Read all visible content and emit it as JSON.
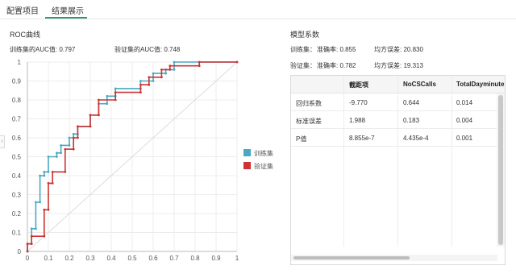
{
  "tabs": [
    {
      "label": "配置项目",
      "active": false
    },
    {
      "label": "结果展示",
      "active": true
    }
  ],
  "roc": {
    "title": "ROC曲线",
    "train_auc_label": "训练集的AUC值: 0.797",
    "valid_auc_label": "验证集的AUC值: 0.748",
    "legend": [
      {
        "name": "训练集",
        "color": "#4aa9c0"
      },
      {
        "name": "验证集",
        "color": "#cc3333"
      }
    ]
  },
  "chart_data": {
    "type": "line",
    "title": "",
    "xlabel": "",
    "ylabel": "",
    "xlim": [
      0,
      1
    ],
    "ylim": [
      0,
      1
    ],
    "xticks": [
      "0",
      "0.1",
      "0.2",
      "0.3",
      "0.4",
      "0.5",
      "0.6",
      "0.7",
      "0.8",
      "0.9",
      "1"
    ],
    "yticks": [
      "0",
      "0.1",
      "0.2",
      "0.3",
      "0.4",
      "0.5",
      "0.6",
      "0.7",
      "0.8",
      "0.9",
      "1"
    ],
    "grid": true,
    "legend_position": "right",
    "diagonal": true,
    "series": [
      {
        "name": "训练集",
        "color": "#4aa9c0",
        "x": [
          0,
          0,
          0.02,
          0.02,
          0.04,
          0.04,
          0.06,
          0.06,
          0.08,
          0.08,
          0.1,
          0.1,
          0.14,
          0.14,
          0.16,
          0.16,
          0.2,
          0.2,
          0.22,
          0.22,
          0.24,
          0.24,
          0.3,
          0.3,
          0.34,
          0.34,
          0.38,
          0.38,
          0.42,
          0.42,
          0.54,
          0.54,
          0.6,
          0.6,
          0.66,
          0.66,
          0.7,
          0.7,
          1.0
        ],
        "y": [
          0,
          0.04,
          0.04,
          0.12,
          0.12,
          0.26,
          0.26,
          0.4,
          0.4,
          0.42,
          0.42,
          0.5,
          0.5,
          0.52,
          0.52,
          0.56,
          0.56,
          0.6,
          0.6,
          0.62,
          0.62,
          0.66,
          0.66,
          0.72,
          0.72,
          0.78,
          0.78,
          0.82,
          0.82,
          0.86,
          0.86,
          0.9,
          0.9,
          0.94,
          0.94,
          0.96,
          0.96,
          1.0,
          1.0
        ]
      },
      {
        "name": "验证集",
        "color": "#cc3333",
        "x": [
          0,
          0,
          0.02,
          0.02,
          0.08,
          0.08,
          0.1,
          0.1,
          0.12,
          0.12,
          0.18,
          0.18,
          0.22,
          0.22,
          0.24,
          0.24,
          0.3,
          0.3,
          0.34,
          0.34,
          0.42,
          0.42,
          0.54,
          0.54,
          0.58,
          0.58,
          0.64,
          0.64,
          0.68,
          0.68,
          0.82,
          0.82,
          1.0
        ],
        "y": [
          0,
          0.04,
          0.04,
          0.08,
          0.08,
          0.22,
          0.22,
          0.36,
          0.36,
          0.42,
          0.42,
          0.54,
          0.54,
          0.6,
          0.6,
          0.66,
          0.66,
          0.72,
          0.72,
          0.8,
          0.8,
          0.84,
          0.84,
          0.88,
          0.88,
          0.92,
          0.92,
          0.96,
          0.96,
          0.98,
          0.98,
          1.0,
          1.0
        ]
      }
    ]
  },
  "model": {
    "title": "模型系数",
    "train_stats": {
      "label": "训练集：",
      "acc_label": "准确率: 0.855",
      "mse_label": "均方误差: 20.830"
    },
    "valid_stats": {
      "label": "验证集：",
      "acc_label": "准确率: 0.782",
      "mse_label": "均方误差: 19.313"
    },
    "columns": [
      "",
      "截距项",
      "NoCSCalls",
      "TotalDayminute"
    ],
    "rows": [
      [
        "回归系数",
        "-9.770",
        "0.644",
        "0.014"
      ],
      [
        "标准误差",
        "1.988",
        "0.183",
        "0.004"
      ],
      [
        "P值",
        "8.855e-7",
        "4.435e-4",
        "0.001"
      ]
    ]
  }
}
